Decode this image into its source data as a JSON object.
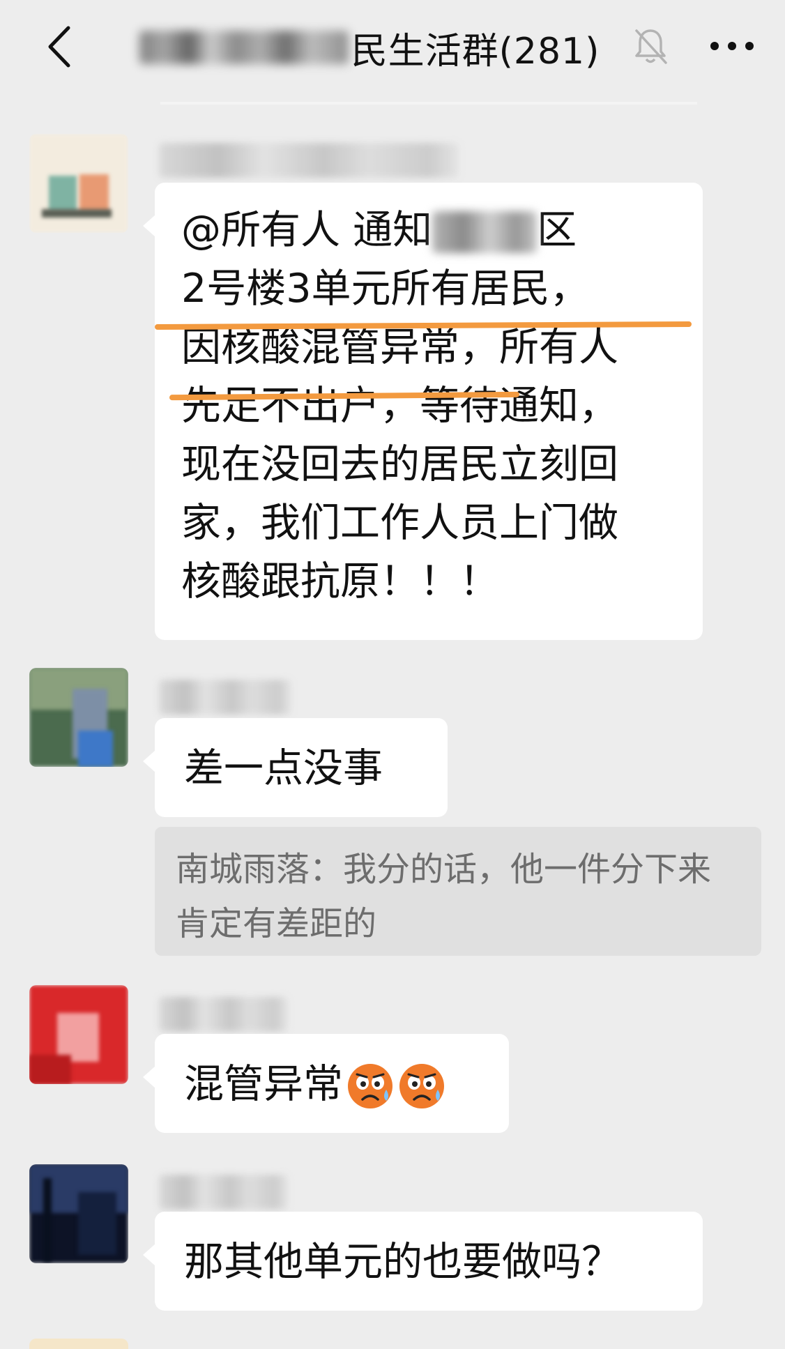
{
  "header": {
    "title_suffix": "民生活群(281)",
    "back_icon": "chevron-left-icon",
    "mute_icon": "bell-off-icon",
    "more_icon": "more-dots-icon"
  },
  "messages": [
    {
      "avatar_colors": [
        "#f3ecdf",
        "#7fb3a3",
        "#e89a73"
      ],
      "lines": [
        "@所有人  通知",
        "2号楼3单元所有居民，",
        "因核酸混管异常，所有人",
        "先足不出户，等待通知，",
        "现在没回去的居民立刻回",
        "家，我们工作人员上门做",
        "核酸跟抗原！！！"
      ],
      "line1_tail": "区"
    },
    {
      "avatar_colors": [
        "#4b6b4e",
        "#7d8fa6",
        "#3e78c8"
      ],
      "text": "差一点没事",
      "quote": "南城雨落：我分的话，他一件分下来肯定有差距的"
    },
    {
      "avatar_colors": [
        "#d9282a",
        "#f2a0a0",
        "#b81c1e"
      ],
      "text": "混管异常",
      "emoji": [
        "anxious-sweat-face-icon",
        "anxious-sweat-face-icon"
      ]
    },
    {
      "avatar_colors": [
        "#0d1326",
        "#2a3b66",
        "#09101f"
      ],
      "text": "那其他单元的也要做吗？"
    }
  ],
  "colors": {
    "background": "#ededed",
    "bubble": "#ffffff",
    "highlight": "#f39a3f",
    "quote_bg": "#e0e0e0"
  }
}
